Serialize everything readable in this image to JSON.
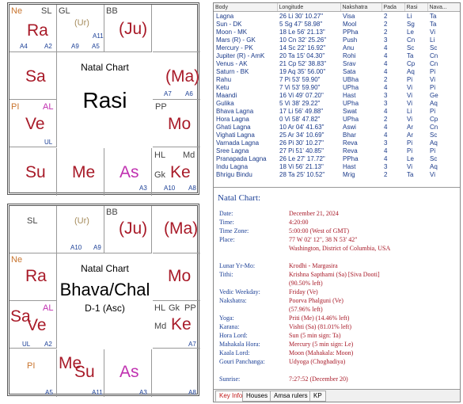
{
  "rasi_chart": {
    "title": "Natal Chart",
    "name": "Rasi",
    "cells": [
      {
        "texts": [
          {
            "t": "Ne",
            "c": "org",
            "k": "sm"
          },
          {
            "t": "SL",
            "c": "gry",
            "k": "sm"
          },
          {
            "t": "Ra",
            "c": "red",
            "k": "big"
          },
          {
            "t": "A4",
            "c": "blu",
            "k": "av"
          },
          {
            "t": "A2",
            "c": "blu",
            "k": "av"
          }
        ]
      },
      {
        "texts": [
          {
            "t": "GL",
            "c": "gry",
            "k": "sm"
          },
          {
            "t": "(Ur)",
            "c": "olive",
            "k": "sm"
          },
          {
            "t": "A11",
            "c": "blu",
            "k": "av"
          },
          {
            "t": "A9",
            "c": "blu",
            "k": "av"
          },
          {
            "t": "A5",
            "c": "blu",
            "k": "av"
          }
        ]
      },
      {
        "texts": [
          {
            "t": "BB",
            "c": "gry",
            "k": "sm"
          },
          {
            "t": "(Ju)",
            "c": "red",
            "k": "big"
          }
        ]
      },
      {
        "texts": [
          {
            "t": "Sa",
            "c": "red",
            "k": "big"
          }
        ]
      },
      {
        "texts": [
          {
            "t": "(Ma)",
            "c": "red",
            "k": "big"
          },
          {
            "t": "A7",
            "c": "blu",
            "k": "av"
          },
          {
            "t": "A6",
            "c": "blu",
            "k": "av"
          }
        ]
      },
      {
        "texts": [
          {
            "t": "PI",
            "c": "org",
            "k": "sm"
          },
          {
            "t": "AL",
            "c": "mag",
            "k": "sm"
          },
          {
            "t": "Ve",
            "c": "red",
            "k": "big"
          },
          {
            "t": "UL",
            "c": "blu",
            "k": "av"
          }
        ]
      },
      {
        "texts": [
          {
            "t": "PP",
            "c": "gry",
            "k": "sm"
          },
          {
            "t": "Mo",
            "c": "red",
            "k": "big"
          }
        ]
      },
      {
        "texts": [
          {
            "t": "Su",
            "c": "red",
            "k": "big"
          }
        ]
      },
      {
        "texts": [
          {
            "t": "Me",
            "c": "red",
            "k": "big"
          }
        ]
      },
      {
        "texts": [
          {
            "t": "As",
            "c": "mag",
            "k": "big"
          },
          {
            "t": "A3",
            "c": "blu",
            "k": "av"
          }
        ]
      },
      {
        "texts": [
          {
            "t": "HL",
            "c": "gry",
            "k": "sm"
          },
          {
            "t": "Md",
            "c": "gry",
            "k": "sm"
          },
          {
            "t": "Gk",
            "c": "gry",
            "k": "sm"
          },
          {
            "t": "Ke",
            "c": "red",
            "k": "big"
          },
          {
            "t": "A10",
            "c": "blu",
            "k": "av"
          },
          {
            "t": "A8",
            "c": "blu",
            "k": "av"
          }
        ]
      }
    ]
  },
  "bhava_chart": {
    "title": "Natal Chart",
    "name": "Bhava/Chal",
    "subtitle": "D-1 (Asc)",
    "cells": [
      {
        "texts": [
          {
            "t": "SL",
            "c": "gry",
            "k": "sm"
          }
        ]
      },
      {
        "texts": [
          {
            "t": "(Ur)",
            "c": "olive",
            "k": "sm"
          },
          {
            "t": "A10",
            "c": "blu",
            "k": "av"
          },
          {
            "t": "A9",
            "c": "blu",
            "k": "av"
          }
        ]
      },
      {
        "texts": [
          {
            "t": "BB",
            "c": "gry",
            "k": "sm"
          },
          {
            "t": "(Ju)",
            "c": "red",
            "k": "big"
          }
        ]
      },
      {
        "texts": [
          {
            "t": "(Ma)",
            "c": "red",
            "k": "big"
          }
        ]
      },
      {
        "texts": [
          {
            "t": "Ne",
            "c": "org",
            "k": "sm"
          },
          {
            "t": "Ra",
            "c": "red",
            "k": "big"
          }
        ]
      },
      {
        "texts": [
          {
            "t": "Mo",
            "c": "red",
            "k": "big"
          }
        ]
      },
      {
        "texts": [
          {
            "t": "AL",
            "c": "mag",
            "k": "sm"
          },
          {
            "t": "Sa",
            "c": "red",
            "k": "big"
          },
          {
            "t": "Ve",
            "c": "red",
            "k": "big"
          },
          {
            "t": "UL",
            "c": "blu",
            "k": "av"
          },
          {
            "t": "A2",
            "c": "blu",
            "k": "av"
          }
        ]
      },
      {
        "texts": [
          {
            "t": "HL",
            "c": "gry",
            "k": "sm"
          },
          {
            "t": "Gk",
            "c": "gry",
            "k": "sm"
          },
          {
            "t": "PP",
            "c": "gry",
            "k": "sm"
          },
          {
            "t": "Md",
            "c": "gry",
            "k": "sm"
          },
          {
            "t": "Ke",
            "c": "red",
            "k": "big"
          },
          {
            "t": "A7",
            "c": "blu",
            "k": "av"
          }
        ]
      },
      {
        "texts": [
          {
            "t": "PI",
            "c": "org",
            "k": "sm"
          },
          {
            "t": "A5",
            "c": "blu",
            "k": "av"
          }
        ]
      },
      {
        "texts": [
          {
            "t": "Me",
            "c": "red",
            "k": "big"
          },
          {
            "t": "Su",
            "c": "red",
            "k": "big"
          },
          {
            "t": "A11",
            "c": "blu",
            "k": "av"
          }
        ]
      },
      {
        "texts": [
          {
            "t": "As",
            "c": "mag",
            "k": "big"
          },
          {
            "t": "A3",
            "c": "blu",
            "k": "av"
          }
        ]
      },
      {
        "texts": [
          {
            "t": "A8",
            "c": "blu",
            "k": "av"
          }
        ]
      }
    ]
  },
  "planet_table": {
    "headers": [
      "Body",
      "Longitude",
      "Nakshatra",
      "Pada",
      "Rasi",
      "Nava..."
    ],
    "rows": [
      [
        "Lagna",
        "26 Li 30' 10.27\"",
        "Visa",
        "2",
        "Li",
        "Ta"
      ],
      [
        "Sun - DK",
        "5 Sg 47' 58.98\"",
        "Mool",
        "2",
        "Sg",
        "Ta"
      ],
      [
        "Moon - MK",
        "18 Le 56' 21.13\"",
        "PPha",
        "2",
        "Le",
        "Vi"
      ],
      [
        "Mars (R) - GK",
        "10 Cn 32' 25.26\"",
        "Push",
        "3",
        "Cn",
        "Li"
      ],
      [
        "Mercury - PK",
        "14 Sc 22' 16.92\"",
        "Anu",
        "4",
        "Sc",
        "Sc"
      ],
      [
        "Jupiter (R) - AmK",
        "20 Ta 15' 04.30\"",
        "Rohi",
        "4",
        "Ta",
        "Cn"
      ],
      [
        "Venus - AK",
        "21 Cp 52' 38.83\"",
        "Srav",
        "4",
        "Cp",
        "Cn"
      ],
      [
        "Saturn - BK",
        "19 Aq 35' 56.00\"",
        "Sata",
        "4",
        "Aq",
        "Pi"
      ],
      [
        "Rahu",
        "7 Pi 53' 59.90\"",
        "UBha",
        "2",
        "Pi",
        "Vi"
      ],
      [
        "Ketu",
        "7 Vi 53' 59.90\"",
        "UPha",
        "4",
        "Vi",
        "Pi"
      ],
      [
        "Maandi",
        "16 Vi 49' 07.20\"",
        "Hast",
        "3",
        "Vi",
        "Ge"
      ],
      [
        "Gulika",
        "5 Vi 38' 29.22\"",
        "UPha",
        "3",
        "Vi",
        "Aq"
      ],
      [
        "Bhava Lagna",
        "17 Li 56' 49.88\"",
        "Swat",
        "4",
        "Li",
        "Pi"
      ],
      [
        "Hora Lagna",
        "0 Vi 58' 47.82\"",
        "UPha",
        "2",
        "Vi",
        "Cp"
      ],
      [
        "Ghati Lagna",
        "10 Ar 04' 41.63\"",
        "Aswi",
        "4",
        "Ar",
        "Cn"
      ],
      [
        "Vighati Lagna",
        "25 Ar 34' 10.69\"",
        "Bhar",
        "4",
        "Ar",
        "Sc"
      ],
      [
        "Varnada Lagna",
        "26 Pi 30' 10.27\"",
        "Reva",
        "3",
        "Pi",
        "Aq"
      ],
      [
        "Sree Lagna",
        "27 Pi 51' 40.85\"",
        "Reva",
        "4",
        "Pi",
        "Pi"
      ],
      [
        "Pranapada Lagna",
        "26 Le 27' 17.72\"",
        "PPha",
        "4",
        "Le",
        "Sc"
      ],
      [
        "Indu Lagna",
        "18 Vi 56' 21.13\"",
        "Hast",
        "3",
        "Vi",
        "Aq"
      ],
      [
        "Bhrigu Bindu",
        "28 Ta 25' 10.52\"",
        "Mrig",
        "2",
        "Ta",
        "Vi"
      ]
    ]
  },
  "details": {
    "title": "Natal Chart:",
    "rows": [
      {
        "label": "Date:",
        "value": "December 21, 2024"
      },
      {
        "label": "Time:",
        "value": "4:20:00"
      },
      {
        "label": "Time Zone:",
        "value": "5:00:00 (West of GMT)"
      },
      {
        "label": "Place:",
        "value": "77 W 02' 12\", 38 N 53' 42\""
      },
      {
        "label": "",
        "value": "Washington, District of Columbia, USA"
      },
      {
        "label": "",
        "value": ""
      },
      {
        "label": "Lunar Yr-Mo:",
        "value": "Krodhi - Margasira"
      },
      {
        "label": "Tithi:",
        "value": "Krishna Sapthami (Sa) [Siva Dooti]"
      },
      {
        "label": "",
        "value": "(90.50% left)"
      },
      {
        "label": "Vedic Weekday:",
        "value": "Friday (Ve)"
      },
      {
        "label": "Nakshatra:",
        "value": "Poorva Phalguni (Ve)"
      },
      {
        "label": "",
        "value": "(57.96% left)"
      },
      {
        "label": "Yoga:",
        "value": "Priti (Me) (14.46% left)"
      },
      {
        "label": "Karana:",
        "value": "Vishti (Sa) (81.01% left)"
      },
      {
        "label": "Hora Lord:",
        "value": "Sun (5 min sign: Ta)"
      },
      {
        "label": "Mahakala Hora:",
        "value": "Mercury (5 min sign: Le)"
      },
      {
        "label": "Kaala Lord:",
        "value": "Moon (Mahakala: Moon)"
      },
      {
        "label": "Gouri Panchanga:",
        "value": "Udyoga (Choghadiya)"
      },
      {
        "label": "",
        "value": ""
      },
      {
        "label": "Sunrise:",
        "value": "7:27:52 (December 20)"
      }
    ]
  },
  "tabs": [
    "Key Info",
    "Houses",
    "Amsa rulers",
    "KP"
  ]
}
